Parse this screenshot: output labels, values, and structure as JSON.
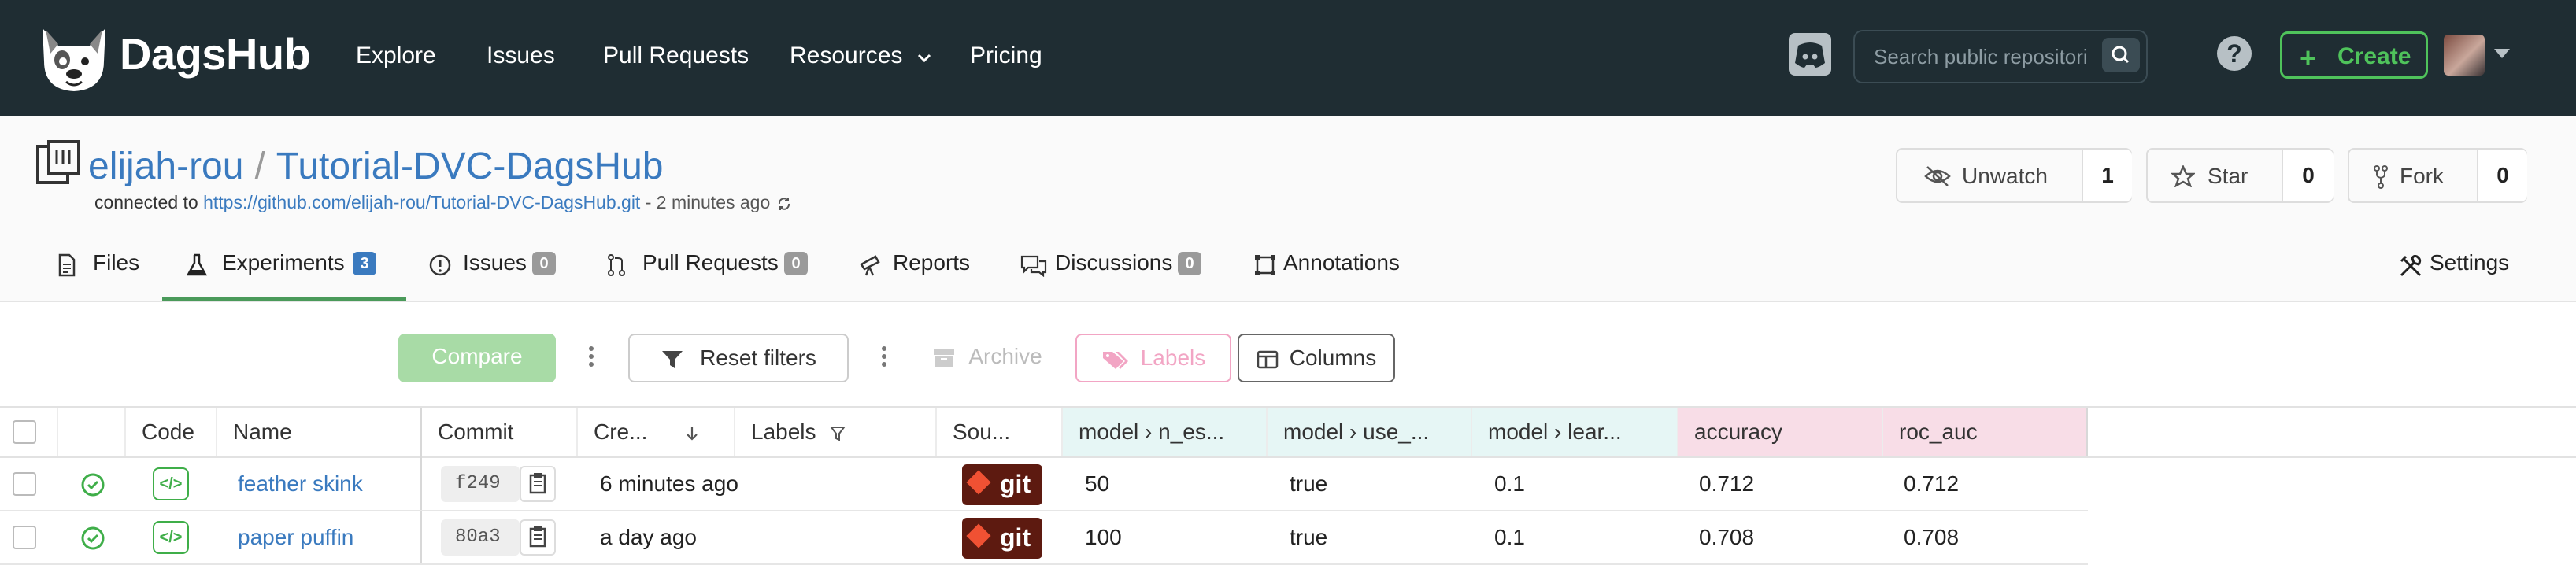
{
  "nav": {
    "brand": "DagsHub",
    "links": [
      "Explore",
      "Issues",
      "Pull Requests",
      "Resources",
      "Pricing"
    ],
    "search_placeholder": "Search public repositories...",
    "create_label": "Create"
  },
  "repo": {
    "owner": "elijah-rou",
    "name": "Tutorial-DVC-DagsHub",
    "connected_prefix": "connected to",
    "connected_url": "https://github.com/elijah-rou/Tutorial-DVC-DagsHub.git",
    "connected_ago": "- 2 minutes ago",
    "unwatch_label": "Unwatch",
    "watch_count": "1",
    "star_label": "Star",
    "star_count": "0",
    "fork_label": "Fork",
    "fork_count": "0"
  },
  "tabs": [
    {
      "label": "Files",
      "badge": ""
    },
    {
      "label": "Experiments",
      "badge": "3"
    },
    {
      "label": "Issues",
      "badge": "0"
    },
    {
      "label": "Pull Requests",
      "badge": "0"
    },
    {
      "label": "Reports",
      "badge": ""
    },
    {
      "label": "Discussions",
      "badge": "0"
    },
    {
      "label": "Annotations",
      "badge": ""
    },
    {
      "label": "Settings",
      "badge": ""
    }
  ],
  "toolbar": {
    "compare": "Compare",
    "reset_filters": "Reset filters",
    "archive": "Archive",
    "labels": "Labels",
    "columns": "Columns"
  },
  "table": {
    "headers": {
      "code": "Code",
      "name": "Name",
      "commit": "Commit",
      "created": "Cre...",
      "labels": "Labels",
      "source": "Sou...",
      "n_est": "model › n_es...",
      "use": "model › use_...",
      "lear": "model › lear...",
      "accuracy": "accuracy",
      "roc_auc": "roc_auc"
    },
    "rows": [
      {
        "name": "feather skink",
        "commit": "f249",
        "created": "6 minutes ago",
        "source": "git",
        "n_est": "50",
        "use": "true",
        "lear": "0.1",
        "accuracy": "0.712",
        "roc_auc": "0.712"
      },
      {
        "name": "paper puffin",
        "commit": "80a3",
        "created": "a day ago",
        "source": "git",
        "n_est": "100",
        "use": "true",
        "lear": "0.1",
        "accuracy": "0.708",
        "roc_auc": "0.708"
      }
    ]
  },
  "colors": {
    "navbar_bg": "#1f2d33",
    "link": "#3a7abf",
    "create_green": "#4fc35b",
    "active_tab_underline": "#4a9a5a",
    "hyperparam_header": "#e6f6f5",
    "metric_header": "#f8dde7",
    "git_badge": "#5d1a10"
  },
  "icons": [
    "dagshub-logo-icon",
    "chevron-down-icon",
    "discord-icon",
    "search-icon",
    "help-icon",
    "plus-icon",
    "avatar",
    "repo-icon",
    "sync-icon",
    "eye-slash-icon",
    "star-icon",
    "fork-icon",
    "file-icon",
    "flask-icon",
    "issue-icon",
    "pull-request-icon",
    "telescope-icon",
    "chat-icon",
    "annotation-icon",
    "settings-icon",
    "kebab-icon",
    "filter-icon",
    "archive-icon",
    "tag-icon",
    "columns-icon",
    "sort-down-icon",
    "filter-funnel-icon",
    "check-circle-icon",
    "code-icon",
    "copy-icon",
    "git-icon"
  ]
}
